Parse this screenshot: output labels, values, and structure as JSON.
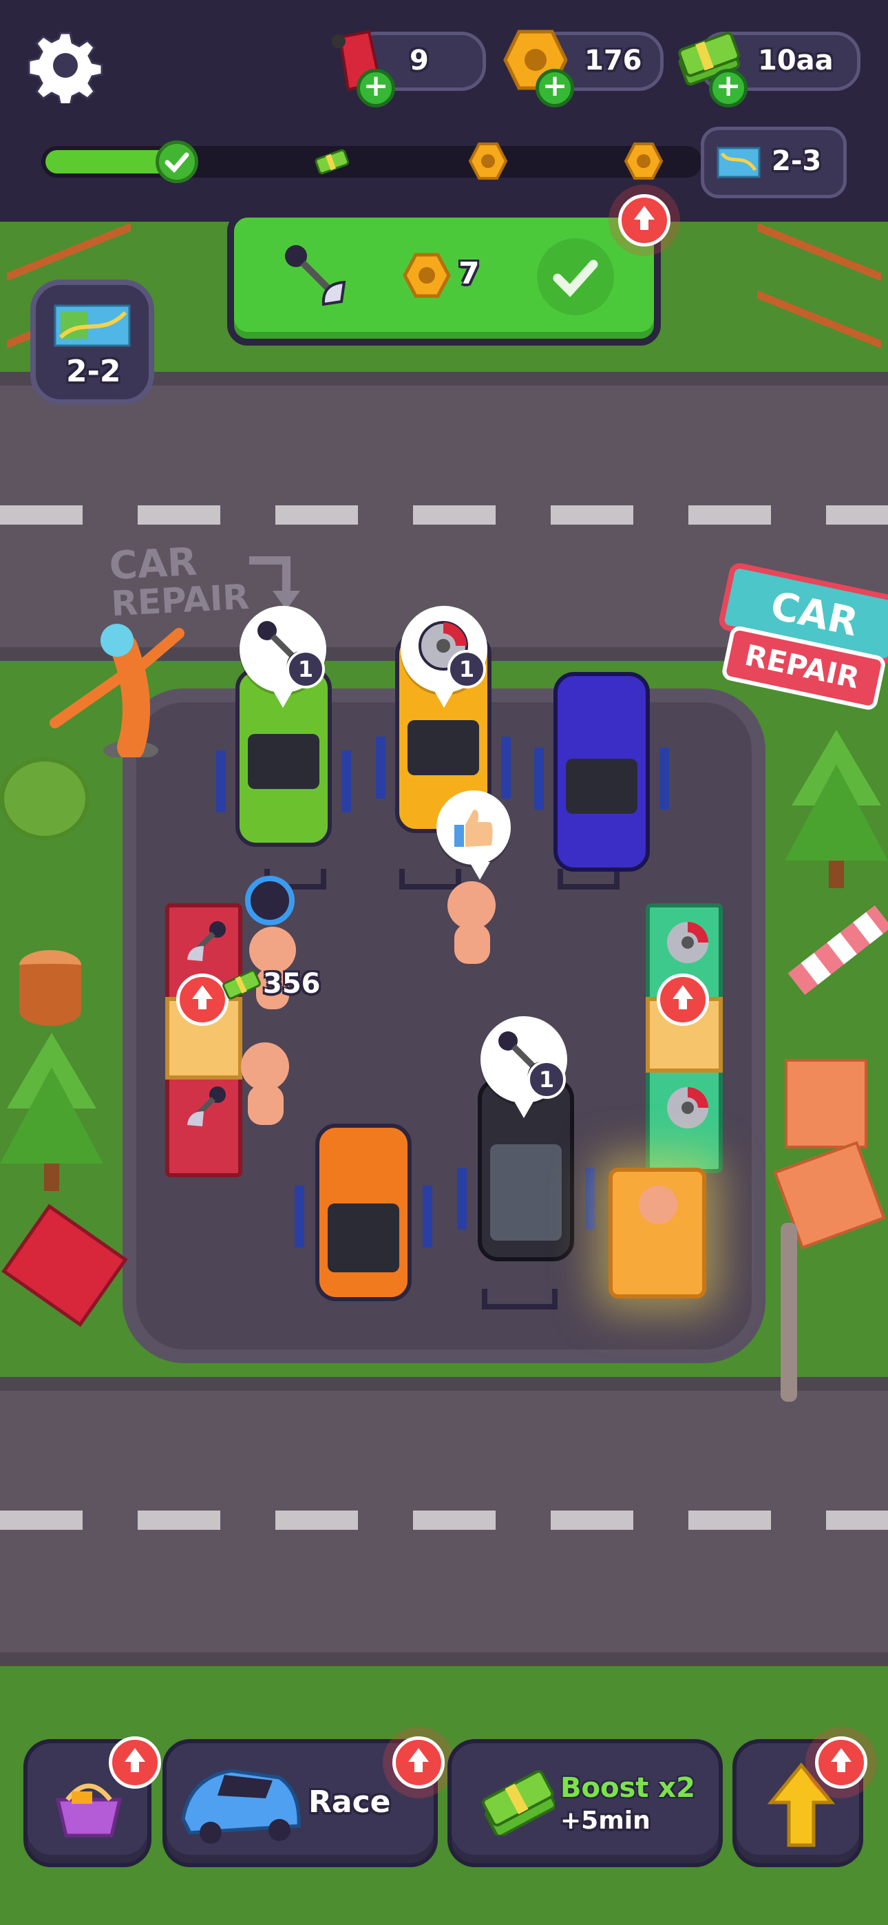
{
  "hud": {
    "settings_icon": "gear-icon",
    "fuel": {
      "icon": "fuel-can-icon",
      "value": "9"
    },
    "nuts": {
      "icon": "hex-nut-icon",
      "value": "176"
    },
    "cash": {
      "icon": "cash-stack-icon",
      "value": "10aa"
    },
    "progress": {
      "percent": 0.2,
      "milestones": [
        "check-icon",
        "cash-stack-icon",
        "hex-nut-icon",
        "hex-nut-icon"
      ]
    },
    "next_level": "2-3"
  },
  "task_panel": {
    "item_icon": "horn-icon",
    "reward_icon": "hex-nut-icon",
    "reward_value": "7",
    "status_icon": "check-icon"
  },
  "prev_level": "2-2",
  "scene": {
    "ground_text_line1": "CAR",
    "ground_text_line2": "REPAIR",
    "sign_line1": "CAR",
    "sign_line2": "REPAIR",
    "lifts": [
      {
        "car_color": "green",
        "request_icon": "horn-icon",
        "request_count": "1"
      },
      {
        "car_color": "yellow",
        "request_icon": "brake-disc-icon",
        "request_count": "1"
      },
      {
        "car_color": "blue"
      },
      {
        "car_color": "orange"
      },
      {
        "car_color": "black",
        "request_icon": "horn-icon",
        "request_count": "1"
      }
    ],
    "worker_earning": "356"
  },
  "bottom_bar": {
    "shop_icon": "shopping-basket-icon",
    "race_label": "Race",
    "boost_line1": "Boost x2",
    "boost_line2": "+5min",
    "upgrade_icon": "arrow-up-icon"
  },
  "colors": {
    "grass": "#4a8a2e",
    "road": "#5e5561",
    "panel": "#3b3656",
    "accent_green": "#4cc93a",
    "alert_red": "#f04545"
  }
}
